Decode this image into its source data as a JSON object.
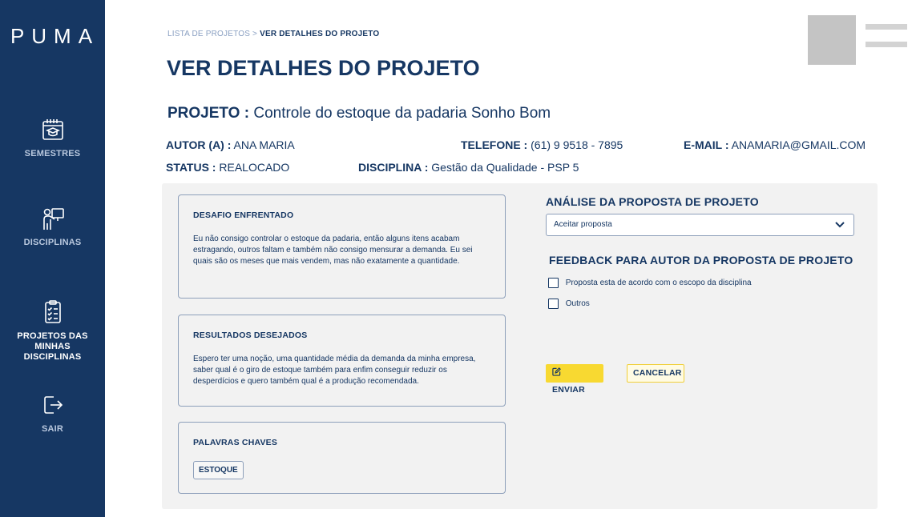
{
  "app": {
    "logo": "PUMA"
  },
  "sidebar": {
    "items": [
      {
        "label": "SEMESTRES",
        "icon": "calendar-graduation-icon"
      },
      {
        "label": "DISCIPLINAS",
        "icon": "teacher-board-icon"
      },
      {
        "label": "PROJETOS DAS MINHAS DISCIPLINAS",
        "icon": "clipboard-checklist-icon",
        "active": true
      },
      {
        "label": "SAIR",
        "icon": "logout-icon"
      }
    ]
  },
  "breadcrumb": {
    "parent": "LISTA DE PROJETOS",
    "separator": ">",
    "current": "VER DETALHES DO PROJETO"
  },
  "page": {
    "title": "VER DETALHES DO PROJETO"
  },
  "project": {
    "name_label": "PROJETO :",
    "name": "Controle do estoque da padaria Sonho Bom",
    "author_label": "AUTOR (A) :",
    "author": "ANA MARIA",
    "phone_label": "TELEFONE :",
    "phone": "(61)  9 9518 - 7895",
    "email_label": "E-MAIL :",
    "email": "ANAMARIA@GMAIL.COM",
    "status_label": "STATUS :",
    "status": "REALOCADO",
    "discipline_label": "DISCIPLINA :",
    "discipline": "Gestão da Qualidade - PSP 5"
  },
  "cards": {
    "challenge": {
      "title": "DESAFIO ENFRENTADO",
      "text": "Eu não consigo controlar o estoque da padaria, então alguns itens acabam estragando, outros faltam e também não consigo mensurar a demanda. Eu sei quais são os meses que mais vendem, mas não exatamente a quantidade."
    },
    "results": {
      "title": "RESULTADOS DESEJADOS",
      "text": "Espero ter uma noção, uma quantidade média da demanda da minha empresa, saber qual é o giro de estoque também para enfim conseguir reduzir os desperdícios e quero também qual é a produção recomendada."
    },
    "keywords": {
      "title": "PALAVRAS CHAVES",
      "tags": [
        "ESTOQUE"
      ]
    }
  },
  "analysis": {
    "title": "ANÁLISE DA PROPOSTA DE PROJETO",
    "select_value": "Aceitar proposta",
    "feedback_title": "FEEDBACK PARA AUTOR DA PROPOSTA DE PROJETO",
    "options": [
      {
        "label": "Proposta esta de acordo com o escopo da disciplina",
        "checked": false
      },
      {
        "label": "Outros",
        "checked": false
      }
    ],
    "submit_label": "ENVIAR",
    "cancel_label": "CANCELAR"
  },
  "colors": {
    "sidebar": "#163763",
    "primary_text": "#163763",
    "accent": "#f8d931",
    "panel": "#f2f2f2"
  }
}
